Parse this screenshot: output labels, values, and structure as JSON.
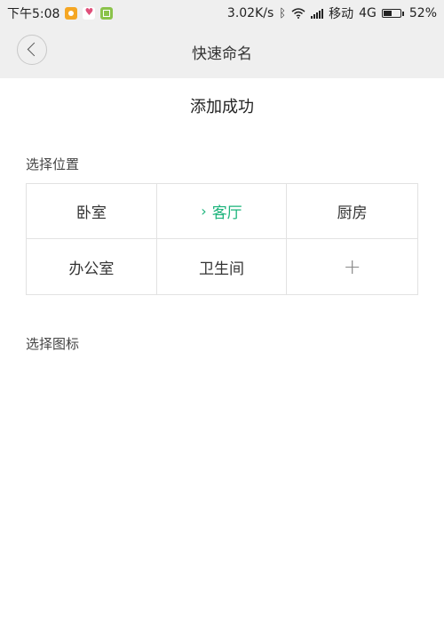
{
  "status_bar": {
    "time": "下午5:08",
    "speed": "3.02K/s",
    "carrier": "移动",
    "network": "4G",
    "battery_percent": "52%",
    "battery_level": 0.52,
    "icons": [
      "app-notification-icon-orange",
      "app-notification-icon-heart",
      "app-notification-icon-green",
      "bluetooth-icon",
      "wifi-icon",
      "signal-icon",
      "battery-icon"
    ]
  },
  "header": {
    "title": "快速命名",
    "back_icon": "chevron-left-icon"
  },
  "main": {
    "success_message": "添加成功",
    "location_label": "选择位置",
    "locations": [
      {
        "label": "卧室",
        "selected": false
      },
      {
        "label": "客厅",
        "selected": true
      },
      {
        "label": "厨房",
        "selected": false
      },
      {
        "label": "办公室",
        "selected": false
      },
      {
        "label": "卫生间",
        "selected": false
      }
    ],
    "add_symbol": "+",
    "selected_marker": "›",
    "icon_label": "选择图标"
  },
  "colors": {
    "accent": "#1ab37a",
    "header_bg": "#efefef",
    "border": "#e2e2e2"
  }
}
